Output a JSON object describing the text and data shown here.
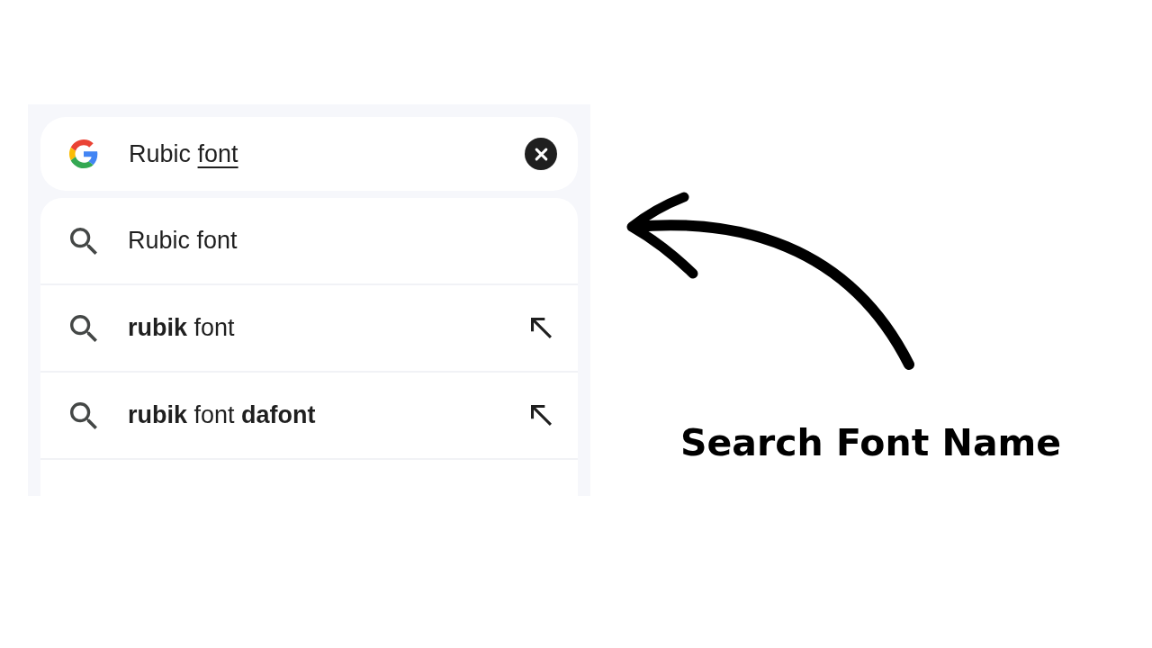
{
  "search": {
    "query_parts": [
      {
        "text": "Rubic",
        "underlined": false
      },
      {
        "text": "font",
        "underlined": true
      }
    ]
  },
  "suggestions": [
    {
      "text": "Rubic font",
      "fill_arrow": false
    },
    {
      "text": "**rubik** font",
      "fill_arrow": true
    },
    {
      "text": "**rubik** font **dafont**",
      "fill_arrow": true
    }
  ],
  "caption": "Search Font Name"
}
